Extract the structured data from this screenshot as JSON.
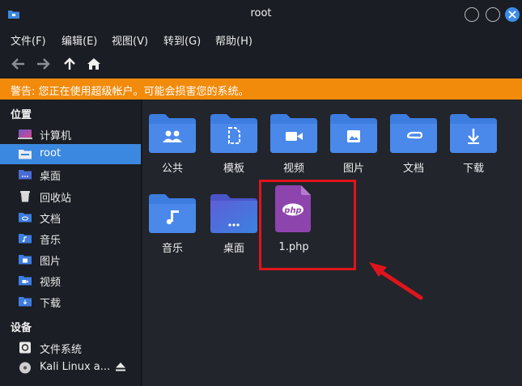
{
  "window": {
    "title": "root"
  },
  "menu": [
    "文件(F)",
    "编辑(E)",
    "视图(V)",
    "转到(G)",
    "帮助(H)"
  ],
  "location": {
    "current": "root"
  },
  "warning": "警告: 您正在使用超级帐户。可能会损害您的系统。",
  "sidebar": {
    "places_header": "位置",
    "places": [
      {
        "label": "计算机",
        "icon": "computer-icon"
      },
      {
        "label": "root",
        "icon": "home-folder-icon",
        "selected": true
      },
      {
        "label": "桌面",
        "icon": "desktop-folder-icon"
      },
      {
        "label": "回收站",
        "icon": "trash-icon"
      },
      {
        "label": "文档",
        "icon": "documents-folder-icon"
      },
      {
        "label": "音乐",
        "icon": "music-folder-icon"
      },
      {
        "label": "图片",
        "icon": "pictures-folder-icon"
      },
      {
        "label": "视频",
        "icon": "videos-folder-icon"
      },
      {
        "label": "下载",
        "icon": "downloads-folder-icon"
      }
    ],
    "devices_header": "设备",
    "devices": [
      {
        "label": "文件系统",
        "icon": "drive-icon"
      },
      {
        "label": "Kali Linux a...",
        "icon": "disc-icon"
      }
    ]
  },
  "files": [
    {
      "name": "公共",
      "icon": "public-folder-icon"
    },
    {
      "name": "模板",
      "icon": "templates-folder-icon"
    },
    {
      "name": "视频",
      "icon": "videos-folder-icon"
    },
    {
      "name": "图片",
      "icon": "pictures-folder-icon"
    },
    {
      "name": "文档",
      "icon": "documents-folder-icon"
    },
    {
      "name": "下载",
      "icon": "downloads-folder-icon"
    },
    {
      "name": "音乐",
      "icon": "music-folder-icon"
    },
    {
      "name": "桌面",
      "icon": "desktop-folder-icon"
    },
    {
      "name": "1.php",
      "icon": "php-file-icon",
      "badge": "php"
    }
  ],
  "colors": {
    "accent": "#3b88e0",
    "warning": "#f28a0b",
    "folder": "#3d7de0",
    "php": "#8e44ad",
    "annotation": "#e0141b"
  }
}
